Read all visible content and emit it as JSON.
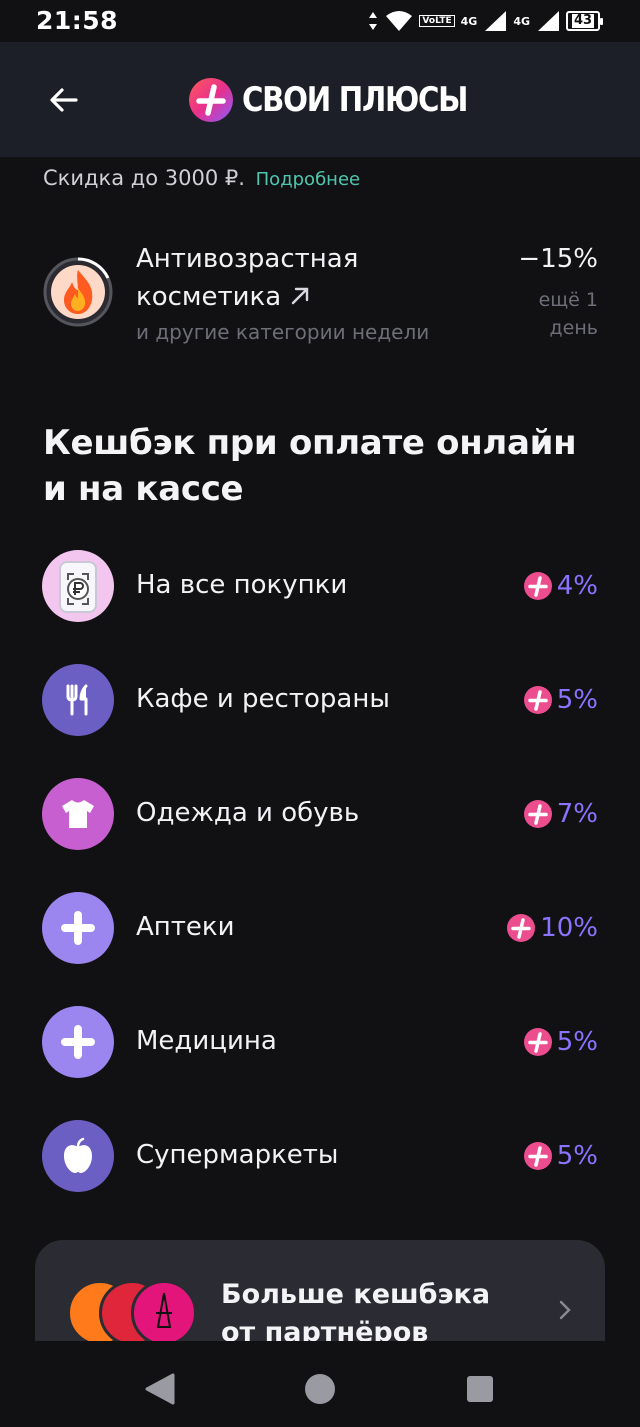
{
  "status_bar": {
    "time": "21:58",
    "volte": "VoLTE",
    "net1": "4G",
    "net2": "4G",
    "battery": "43"
  },
  "header": {
    "title": "СВОИ ПЛЮСЫ",
    "back_icon": "arrow-left-icon"
  },
  "discount": {
    "text": "Скидка до 3000 ₽.",
    "link": "Подробнее"
  },
  "promo": {
    "icon": "flame-icon",
    "title": "Антивозрастная косметика",
    "subtitle": "и другие категории недели",
    "percent": "−15%",
    "time_left": "ещё 1 день"
  },
  "section": {
    "title": "Кешбэк при оплате онлайн и на кассе"
  },
  "cashback": [
    {
      "label": "На все покупки",
      "value": "4%",
      "icon": "ruble-phone-icon",
      "color": "#f3c6f0"
    },
    {
      "label": "Кафе и рестораны",
      "value": "5%",
      "icon": "fork-knife-icon",
      "color": "#6b5fc4"
    },
    {
      "label": "Одежда и обувь",
      "value": "7%",
      "icon": "tshirt-icon",
      "color": "#c85fd0"
    },
    {
      "label": "Аптеки",
      "value": "10%",
      "icon": "medical-cross-icon",
      "color": "#9a86ee"
    },
    {
      "label": "Медицина",
      "value": "5%",
      "icon": "medical-cross-icon",
      "color": "#9a86ee"
    },
    {
      "label": "Супермаркеты",
      "value": "5%",
      "icon": "apple-icon",
      "color": "#6b5fc4"
    }
  ],
  "partners": {
    "title": "Больше кешбэка от партнёров",
    "logo_colors": [
      "#ff7a1a",
      "#e0263a",
      "#e3157a"
    ]
  },
  "nav": {
    "back": "triangle-back-icon",
    "home": "circle-home-icon",
    "recents": "square-recents-icon"
  },
  "colors": {
    "accent": "#8b73ff",
    "link": "#4fc7b0",
    "header_bg": "#1d1f28",
    "background": "#111113"
  }
}
